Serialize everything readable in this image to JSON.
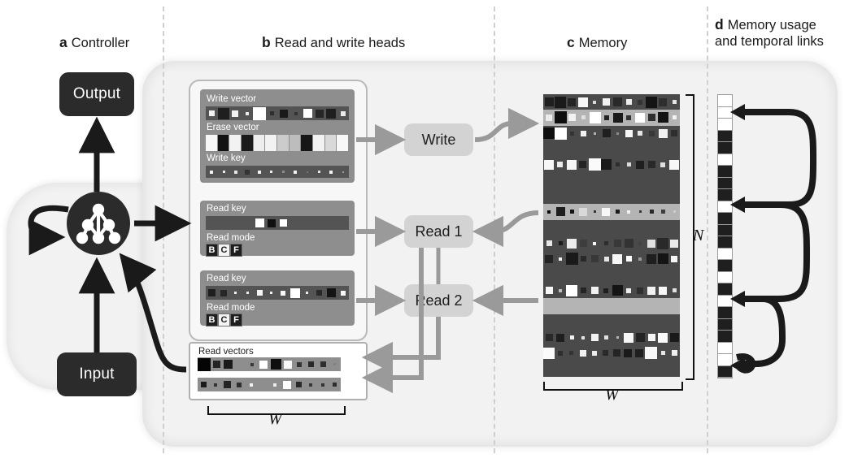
{
  "figure": {
    "panels": [
      {
        "letter": "a",
        "title": "Controller"
      },
      {
        "letter": "b",
        "title": "Read and write heads"
      },
      {
        "letter": "c",
        "title": "Memory"
      },
      {
        "letter": "d",
        "title": "Memory usage\nand temporal links"
      }
    ]
  },
  "controller": {
    "output_label": "Output",
    "input_label": "Input",
    "icon": "neural-network-icon"
  },
  "heads": {
    "write": {
      "title_write_vector": "Write vector",
      "title_erase_vector": "Erase vector",
      "title_write_key": "Write key",
      "write_vector": [
        0.95,
        0.12,
        0.95,
        0.92,
        1.0,
        0.18,
        0.1,
        0.2,
        1.0,
        0.15,
        0.12,
        0.92
      ],
      "write_vector_sizes": [
        0.42,
        0.8,
        0.46,
        0.24,
        0.92,
        0.28,
        0.6,
        0.26,
        0.66,
        0.56,
        0.7,
        0.34
      ],
      "erase_vector": [
        0.97,
        0.07,
        0.95,
        0.1,
        0.93,
        0.95,
        0.8,
        0.74,
        0.09,
        0.95,
        0.85,
        0.97
      ],
      "write_key": [
        0.95,
        0.92,
        0.9,
        0.2,
        0.95,
        0.93,
        0.55,
        0.95,
        0.45,
        0.9,
        0.95,
        0.6
      ],
      "write_key_sizes": [
        0.25,
        0.22,
        0.24,
        0.38,
        0.24,
        0.21,
        0.17,
        0.26,
        0.15,
        0.22,
        0.27,
        0.16
      ]
    },
    "read1": {
      "title_read_key": "Read key",
      "title_read_mode": "Read mode",
      "read_key": [
        null,
        null,
        null,
        null,
        1.0,
        0.06,
        1.0,
        null,
        null,
        null,
        null,
        null
      ],
      "read_key_sizes": [
        0,
        0,
        0,
        0,
        0.62,
        0.56,
        0.52,
        0,
        0,
        0,
        0,
        0
      ],
      "modes": [
        {
          "label": "B",
          "selected": false
        },
        {
          "label": "C",
          "selected": true
        },
        {
          "label": "F",
          "selected": false
        }
      ]
    },
    "read2": {
      "title_read_key": "Read key",
      "title_read_mode": "Read mode",
      "read_key": [
        0.12,
        0.15,
        0.95,
        0.93,
        0.96,
        0.94,
        0.97,
        1.0,
        0.92,
        0.16,
        0.08,
        0.97
      ],
      "read_key_sizes": [
        0.5,
        0.48,
        0.2,
        0.16,
        0.4,
        0.2,
        0.38,
        0.68,
        0.18,
        0.42,
        0.62,
        0.38
      ],
      "modes": [
        {
          "label": "B",
          "selected": false
        },
        {
          "label": "C",
          "selected": true
        },
        {
          "label": "F",
          "selected": false
        }
      ]
    },
    "read_vectors": {
      "title": "Read vectors",
      "row1": [
        0.02,
        0.14,
        0.1,
        0.55,
        0.22,
        1.0,
        0.06,
        0.97,
        0.2,
        0.16,
        0.18,
        0.5
      ],
      "row1_sizes": [
        0.95,
        0.52,
        0.62,
        0.22,
        0.26,
        0.6,
        0.74,
        0.58,
        0.34,
        0.44,
        0.4,
        0.2
      ],
      "row2": [
        0.1,
        0.2,
        0.14,
        0.18,
        0.95,
        0.55,
        0.92,
        1.0,
        0.16,
        0.22,
        0.2,
        0.18
      ],
      "row2_sizes": [
        0.44,
        0.24,
        0.5,
        0.36,
        0.26,
        0.16,
        0.22,
        0.56,
        0.4,
        0.22,
        0.26,
        0.3
      ]
    },
    "width_label": "W"
  },
  "buttons": {
    "write": "Write",
    "read1": "Read 1",
    "read2": "Read 2"
  },
  "memory": {
    "rows_label": "N",
    "width_label": "W",
    "highlighted_rows": [
      1,
      7,
      13
    ],
    "grid": [
      [
        0.12,
        0.1,
        0.14,
        0.97,
        0.85,
        0.95,
        0.16,
        0.93,
        0.2,
        0.08,
        0.18,
        0.9
      ],
      [
        0.92,
        0.06,
        0.95,
        0.88,
        1.0,
        0.14,
        0.1,
        0.2,
        1.0,
        0.18,
        0.08,
        0.95
      ],
      [
        0.06,
        1.0,
        0.2,
        0.95,
        0.7,
        0.12,
        0.55,
        0.97,
        0.9,
        0.22,
        0.95,
        0.18
      ],
      [],
      [
        0.97,
        0.92,
        0.96,
        0.14,
        0.98,
        0.1,
        0.18,
        0.86,
        0.12,
        0.16,
        0.88,
        0.97
      ],
      [],
      [],
      [
        0.04,
        0.12,
        0.08,
        0.85,
        0.2,
        0.97,
        0.1,
        0.95,
        0.22,
        0.16,
        0.24,
        0.8
      ],
      [],
      [
        0.9,
        0.1,
        0.92,
        0.24,
        0.97,
        0.18,
        0.22,
        0.2,
        0.26,
        0.88,
        0.16,
        0.92
      ],
      [
        0.14,
        0.95,
        0.1,
        0.16,
        0.22,
        0.9,
        0.97,
        1.0,
        0.6,
        0.12,
        0.08,
        0.96
      ],
      [],
      [
        0.97,
        0.75,
        1.0,
        0.14,
        0.95,
        0.12,
        0.08,
        0.93,
        0.18,
        0.95,
        0.97,
        0.88
      ],
      [],
      [],
      [
        0.16,
        0.12,
        0.95,
        0.9,
        0.95,
        0.88,
        0.7,
        0.97,
        0.14,
        0.96,
        0.98,
        0.1
      ],
      [
        0.98,
        0.18,
        0.2,
        0.95,
        0.92,
        0.16,
        0.14,
        0.1,
        0.12,
        0.97,
        0.9,
        0.94
      ],
      []
    ],
    "grid_sizes": [
      [
        0.55,
        0.72,
        0.52,
        0.6,
        0.2,
        0.48,
        0.56,
        0.38,
        0.3,
        0.7,
        0.5,
        0.26
      ],
      [
        0.4,
        0.78,
        0.46,
        0.24,
        0.74,
        0.32,
        0.64,
        0.3,
        0.62,
        0.44,
        0.66,
        0.28
      ],
      [
        0.7,
        0.8,
        0.26,
        0.34,
        0.16,
        0.52,
        0.18,
        0.44,
        0.3,
        0.38,
        0.58,
        0.4
      ],
      [],
      [
        0.62,
        0.34,
        0.6,
        0.46,
        0.8,
        0.66,
        0.28,
        0.24,
        0.5,
        0.46,
        0.3,
        0.62
      ],
      [],
      [],
      [
        0.2,
        0.58,
        0.24,
        0.52,
        0.18,
        0.5,
        0.26,
        0.22,
        0.18,
        0.28,
        0.24,
        0.18
      ],
      [],
      [
        0.38,
        0.26,
        0.62,
        0.48,
        0.22,
        0.26,
        0.44,
        0.58,
        0.2,
        0.5,
        0.72,
        0.52
      ],
      [
        0.5,
        0.22,
        0.78,
        0.34,
        0.48,
        0.3,
        0.62,
        0.36,
        0.2,
        0.6,
        0.66,
        0.42
      ],
      [],
      [
        0.44,
        0.2,
        0.74,
        0.34,
        0.46,
        0.32,
        0.66,
        0.3,
        0.42,
        0.5,
        0.54,
        0.24
      ],
      [],
      [],
      [
        0.48,
        0.52,
        0.26,
        0.22,
        0.44,
        0.24,
        0.18,
        0.6,
        0.58,
        0.48,
        0.62,
        0.56
      ],
      [
        0.7,
        0.3,
        0.28,
        0.4,
        0.32,
        0.36,
        0.44,
        0.52,
        0.54,
        0.76,
        0.26,
        0.34
      ],
      []
    ]
  },
  "usage": {
    "cells": [
      0,
      0,
      0,
      1,
      1,
      0,
      1,
      1,
      1,
      0,
      1,
      1,
      1,
      0,
      1,
      0,
      1,
      0,
      1,
      1,
      1,
      0,
      0,
      1
    ],
    "links": 4
  },
  "colors": {
    "dark_box": "#2b2b2b",
    "pill": "#d3d3d3",
    "head_card": "#8e8e8e",
    "memory_bg": "#4a4a4a",
    "memory_highlight": "#b4b4b4",
    "backdrop": "#f2f2f2",
    "divider": "#cfcfcf",
    "arrow_grey": "#9a9a9a",
    "arrow_black": "#1a1a1a"
  }
}
